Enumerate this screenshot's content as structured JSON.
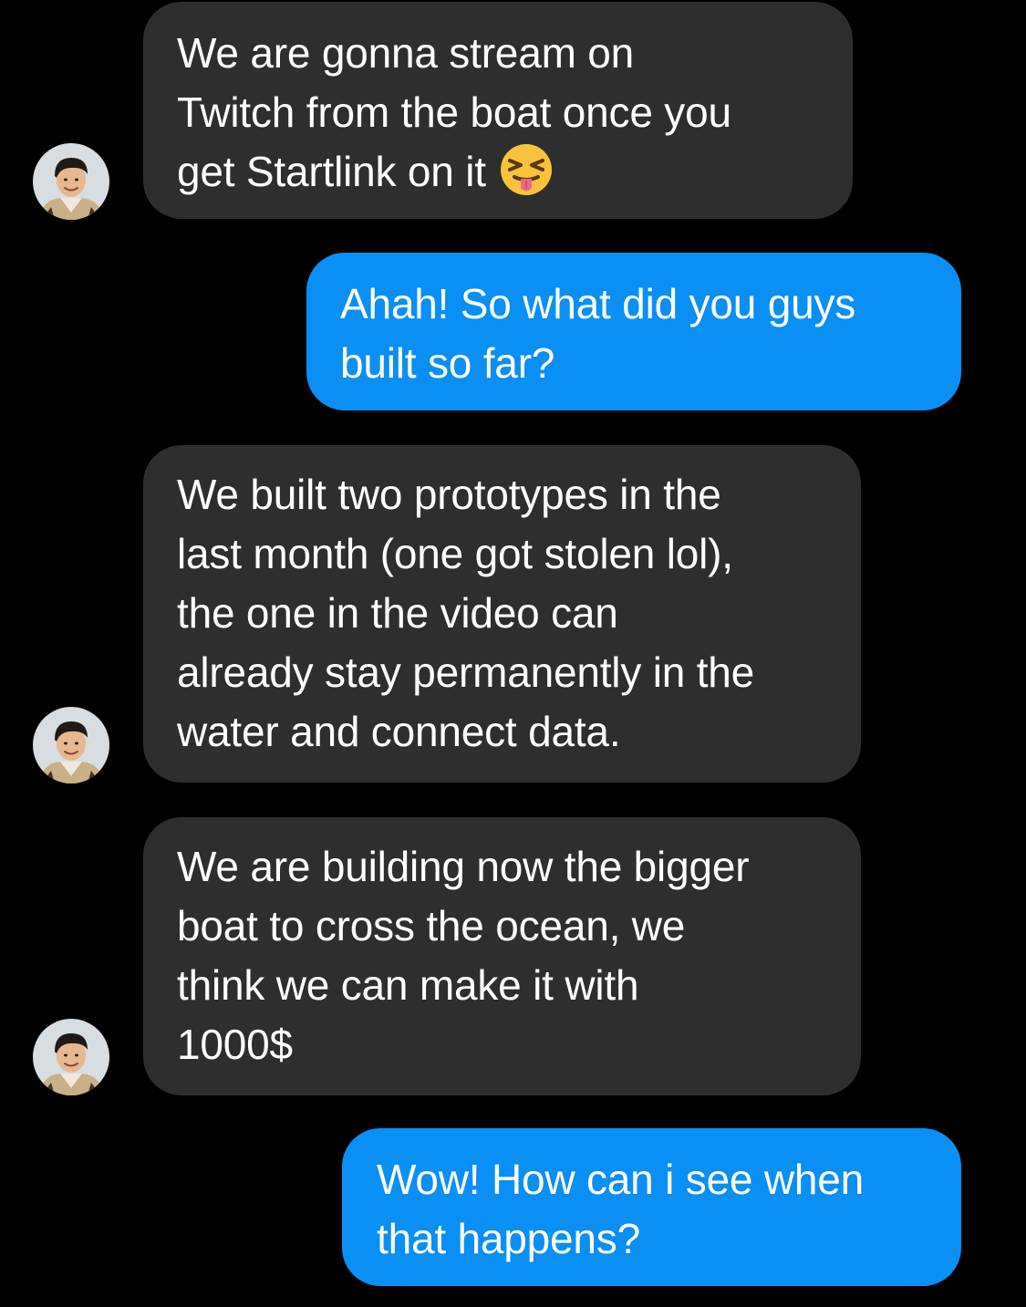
{
  "messages": [
    {
      "sender": "other",
      "text": "We are gonna stream on\nTwitch from the boat once you\nget Startlink on it",
      "emoji": "squinting-face-with-tongue"
    },
    {
      "sender": "me",
      "text": "Ahah! So what did you guys\nbuilt so far?"
    },
    {
      "sender": "other",
      "text": "We built two prototypes in the\nlast month (one got stolen lol),\nthe one in the video can\nalready stay permanently in the\nwater and connect data."
    },
    {
      "sender": "other",
      "text": "We are building now the bigger\nboat to cross the ocean, we\nthink we can make it with\n1000$"
    },
    {
      "sender": "me",
      "text": "Wow! How can i see when\nthat happens?"
    }
  ],
  "colors": {
    "background": "#000000",
    "incoming_bubble": "#2e2e2e",
    "outgoing_bubble": "#0a8ff5",
    "text": "#ffffff"
  }
}
